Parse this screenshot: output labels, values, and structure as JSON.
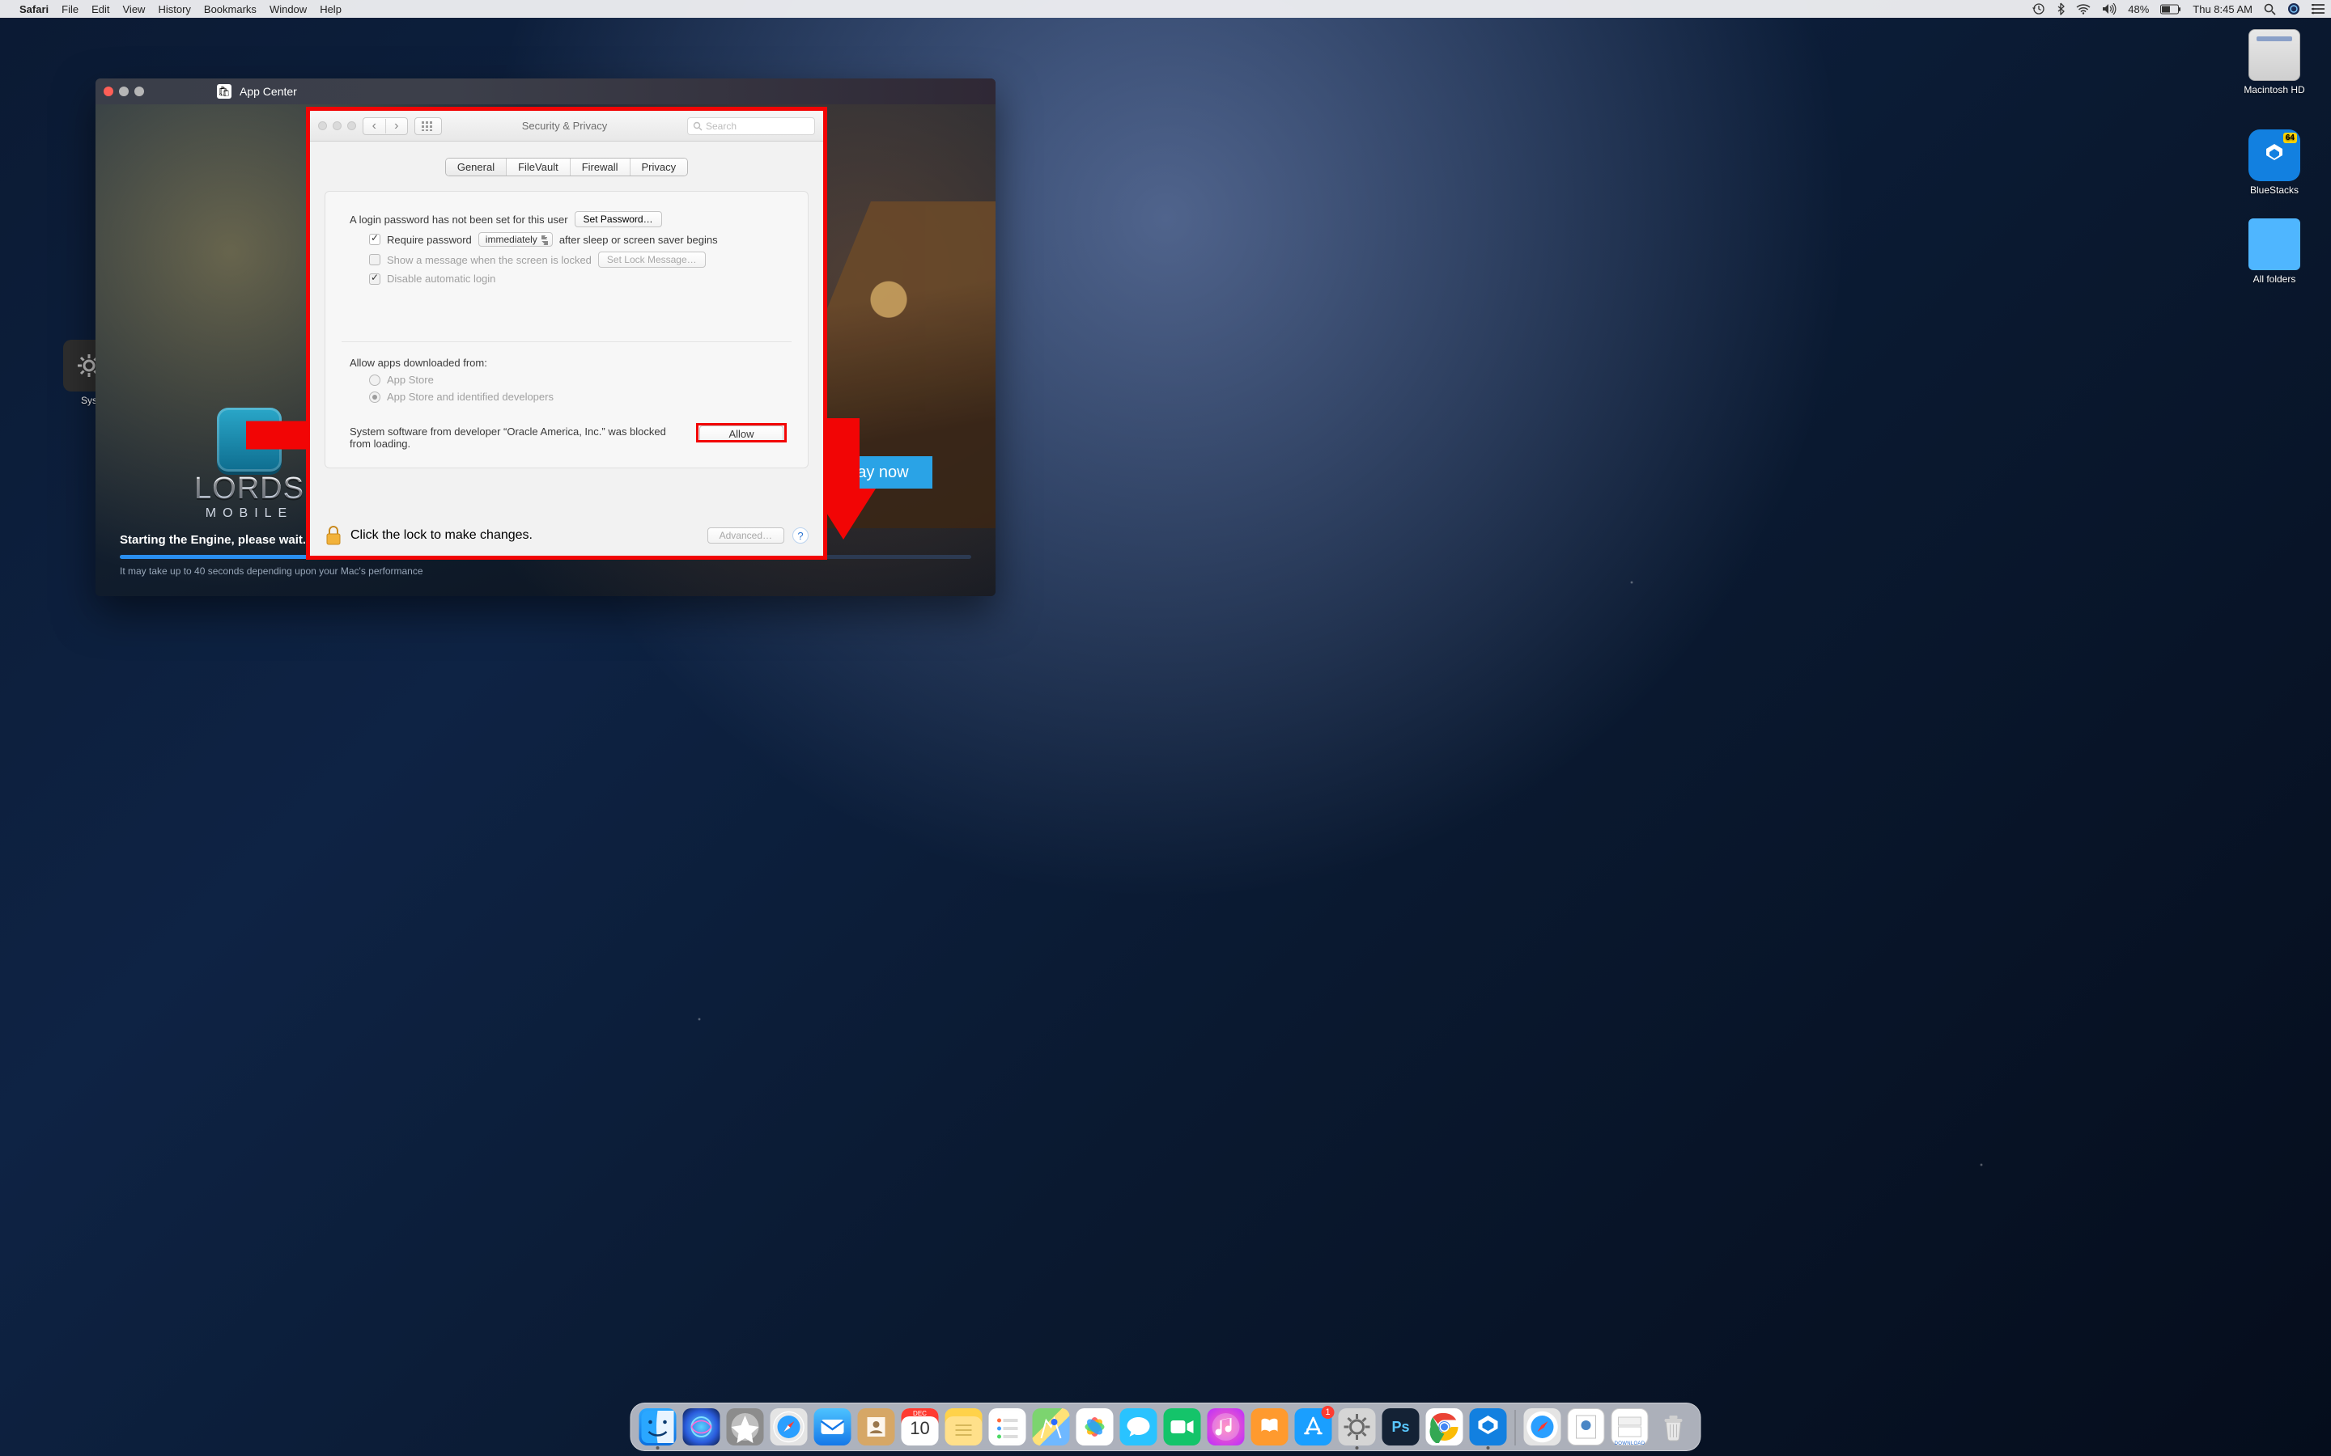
{
  "menubar": {
    "app": "Safari",
    "items": [
      "File",
      "Edit",
      "View",
      "History",
      "Bookmarks",
      "Window",
      "Help"
    ],
    "battery_pct": "48%",
    "clock": "Thu 8:45 AM"
  },
  "desktop_icons": {
    "hd": "Macintosh HD",
    "bluestacks": "BlueStacks",
    "all_folders": "All folders",
    "sys": "Sys"
  },
  "appcenter": {
    "title": "App Center",
    "game_title": "LORDS",
    "game_sub": "MOBILE",
    "play_label": "Play now",
    "status": "Starting the Engine, please wait...",
    "hint": "It may take up to 40 seconds depending upon your Mac's performance"
  },
  "prefs": {
    "title": "Security & Privacy",
    "search_placeholder": "Search",
    "tabs": {
      "general": "General",
      "filevault": "FileVault",
      "firewall": "Firewall",
      "privacy": "Privacy"
    },
    "login_pw_msg": "A login password has not been set for this user",
    "set_password": "Set Password…",
    "require_pw": "Require password",
    "require_pw_when": "immediately",
    "after_sleep": "after sleep or screen saver begins",
    "show_msg": "Show a message when the screen is locked",
    "set_lock_msg": "Set Lock Message…",
    "disable_autologin": "Disable automatic login",
    "allow_from_label": "Allow apps downloaded from:",
    "allow_from_appstore": "App Store",
    "allow_from_identified": "App Store and identified developers",
    "blocked_msg": "System software from developer “Oracle America, Inc.” was blocked from loading.",
    "allow_btn": "Allow",
    "lock_msg": "Click the lock to make changes.",
    "advanced": "Advanced…"
  },
  "dock": {
    "cal_month": "DEC",
    "cal_day": "10",
    "appstore_badge": "1",
    "download_label": "DOWNLOAD"
  }
}
